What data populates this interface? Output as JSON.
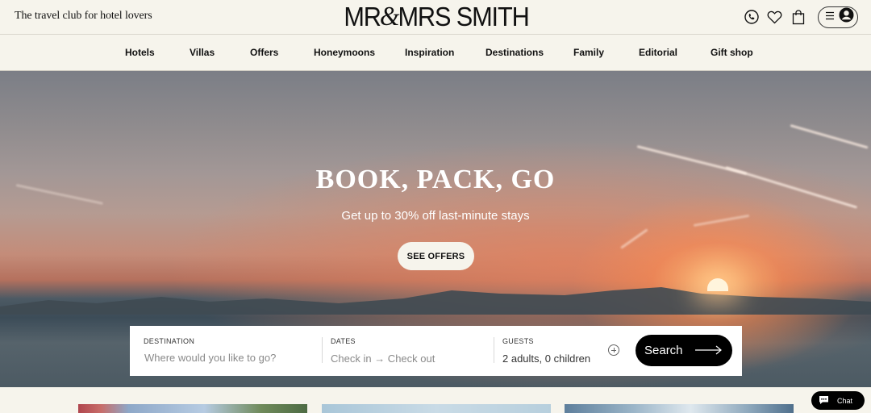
{
  "header": {
    "tagline": "The travel club for hotel lovers",
    "logo_left": "MR",
    "logo_amp": "&",
    "logo_right": "MRS SMITH",
    "icons": [
      "phone-icon",
      "heart-icon",
      "bag-icon",
      "menu-icon",
      "account-icon"
    ]
  },
  "nav": {
    "items": [
      {
        "label": "Hotels"
      },
      {
        "label": "Villas"
      },
      {
        "label": "Offers"
      },
      {
        "label": "Honeymoons"
      },
      {
        "label": "Inspiration"
      },
      {
        "label": "Destinations"
      },
      {
        "label": "Family"
      },
      {
        "label": "Editorial"
      },
      {
        "label": "Gift shop"
      }
    ]
  },
  "hero": {
    "title": "BOOK, PACK, GO",
    "subtitle": "Get up to 30% off last-minute stays",
    "cta": "SEE OFFERS"
  },
  "search": {
    "destination_label": "DESTINATION",
    "destination_placeholder": "Where would you like to go?",
    "dates_label": "DATES",
    "dates_placeholder": "Check in → Check out",
    "guests_label": "GUESTS",
    "guests_value": "2 adults, 0 children",
    "button": "Search"
  },
  "chat": {
    "label": "Chat"
  },
  "colors": {
    "background": "#f6f4ec",
    "button_dark": "#000000",
    "text": "#111111"
  }
}
